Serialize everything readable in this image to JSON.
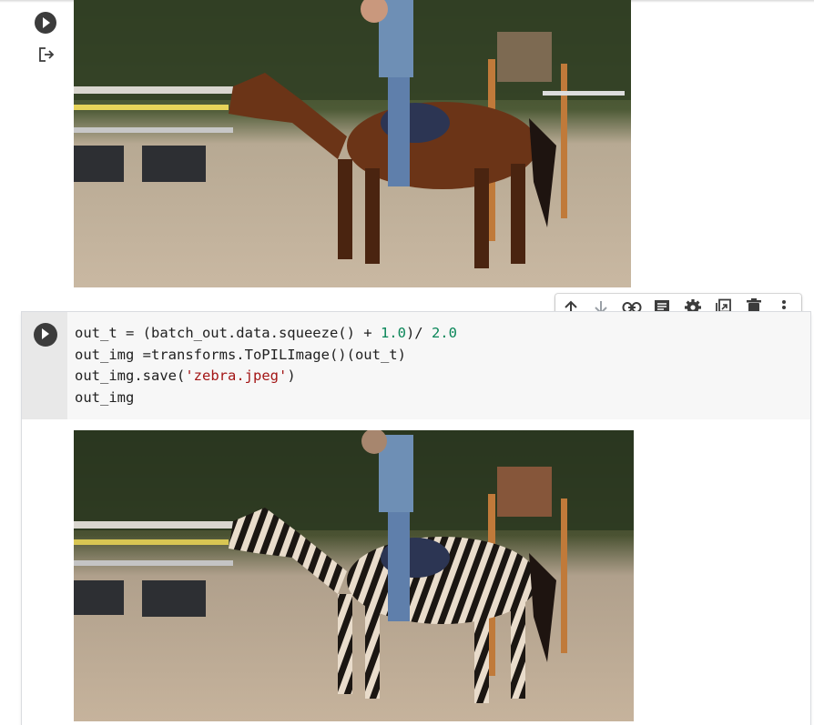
{
  "colors": {
    "accent_number": "#098658",
    "accent_string": "#a31515",
    "icon": "#3c3c3c",
    "icon_disabled": "#9aa0a6"
  },
  "prev_cell": {
    "run_icon": "play-circle-icon",
    "output_icon": "output-redirect-icon",
    "image_desc": "horse"
  },
  "toolbar": {
    "icons": [
      "arrow-up-icon",
      "arrow-down-icon",
      "link-icon",
      "comment-icon",
      "gear-icon",
      "mirror-cell-icon",
      "trash-icon",
      "more-vert-icon"
    ]
  },
  "code_cell": {
    "lines": [
      [
        "out_t = (batch_out.data.squeeze() + ",
        "1.0",
        ")/ ",
        "2.0",
        ""
      ],
      [
        "out_img =transforms.ToPILImage()(out_t)"
      ],
      [
        "out_img.save(",
        "'zebra.jpeg'",
        ")"
      ],
      [
        "out_img"
      ]
    ],
    "tokens": {
      "l1a": "out_t = (batch_out.data.squeeze() + ",
      "l1b": "1.0",
      "l1c": ")/ ",
      "l1d": "2.0",
      "l2": "out_img =transforms.ToPILImage()(out_t)",
      "l3a": "out_img.save(",
      "l3b": "'zebra.jpeg'",
      "l3c": ")",
      "l4": "out_img"
    }
  }
}
